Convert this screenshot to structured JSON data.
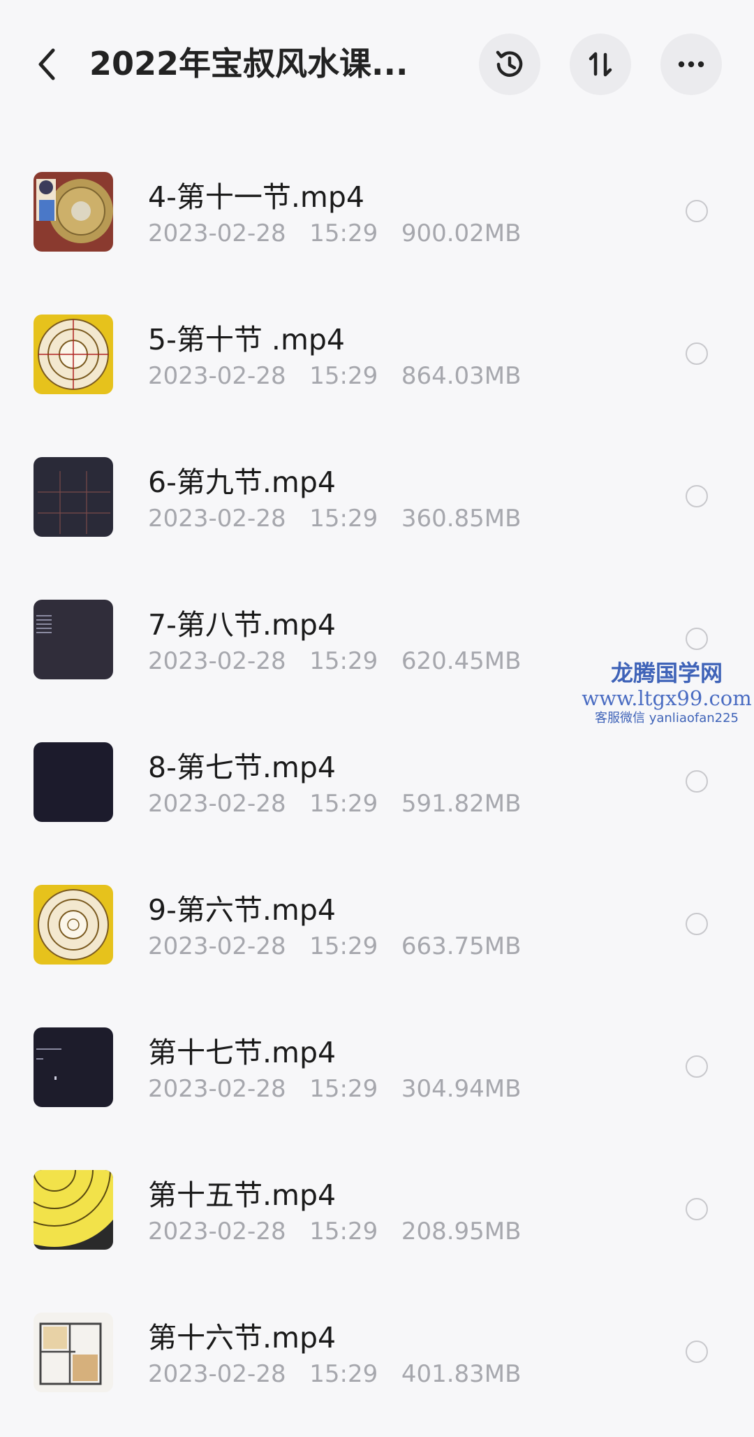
{
  "header": {
    "title": "2022年宝叔风水课..."
  },
  "files": [
    {
      "name": "4-第十一节.mp4",
      "date": "2023-02-28",
      "time": "15:29",
      "size": "900.02MB",
      "thumb": "compass-photo"
    },
    {
      "name": "5-第十节 .mp4",
      "date": "2023-02-28",
      "time": "15:29",
      "size": "864.03MB",
      "thumb": "luopan-yellow"
    },
    {
      "name": "6-第九节.mp4",
      "date": "2023-02-28",
      "time": "15:29",
      "size": "360.85MB",
      "thumb": "grid-chart"
    },
    {
      "name": "7-第八节.mp4",
      "date": "2023-02-28",
      "time": "15:29",
      "size": "620.45MB",
      "thumb": "dark-text"
    },
    {
      "name": "8-第七节.mp4",
      "date": "2023-02-28",
      "time": "15:29",
      "size": "591.82MB",
      "thumb": "dark-blank"
    },
    {
      "name": "9-第六节.mp4",
      "date": "2023-02-28",
      "time": "15:29",
      "size": "663.75MB",
      "thumb": "luopan-yellow"
    },
    {
      "name": "第十七节.mp4",
      "date": "2023-02-28",
      "time": "15:29",
      "size": "304.94MB",
      "thumb": "dark-text"
    },
    {
      "name": "第十五节.mp4",
      "date": "2023-02-28",
      "time": "15:29",
      "size": "208.95MB",
      "thumb": "luopan-large"
    },
    {
      "name": "第十六节.mp4",
      "date": "2023-02-28",
      "time": "15:29",
      "size": "401.83MB",
      "thumb": "floor-plan"
    }
  ],
  "watermark": {
    "line1": "龙腾国学网",
    "line2": "www.ltgx99.com",
    "line3": "客服微信 yanliaofan225"
  },
  "icons": {
    "back": "chevron-left-icon",
    "history": "history-clock-icon",
    "sort": "sort-arrows-icon",
    "more": "more-dots-icon"
  },
  "colors": {
    "background": "#f7f7f9",
    "title": "#222222",
    "meta": "#a6a7ad",
    "watermark": "#3f63b8"
  }
}
